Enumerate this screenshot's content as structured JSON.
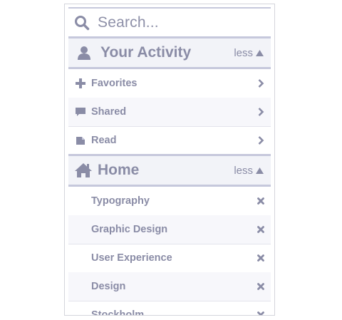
{
  "search": {
    "placeholder": "Search..."
  },
  "sections": [
    {
      "title": "Your Activity",
      "toggle": "less",
      "items": [
        {
          "label": "Favorites",
          "icon": "plus-icon"
        },
        {
          "label": "Shared",
          "icon": "speech-bubble-icon"
        },
        {
          "label": "Read",
          "icon": "document-icon"
        }
      ]
    },
    {
      "title": "Home",
      "toggle": "less",
      "items": [
        {
          "label": "Typography"
        },
        {
          "label": "Graphic Design"
        },
        {
          "label": "User Experience"
        },
        {
          "label": "Design"
        },
        {
          "label": "Stockholm"
        }
      ]
    }
  ],
  "colors": {
    "text": "#8a8ca6",
    "divider": "#c6c8dc",
    "header_bg": "#f2f3f8"
  }
}
